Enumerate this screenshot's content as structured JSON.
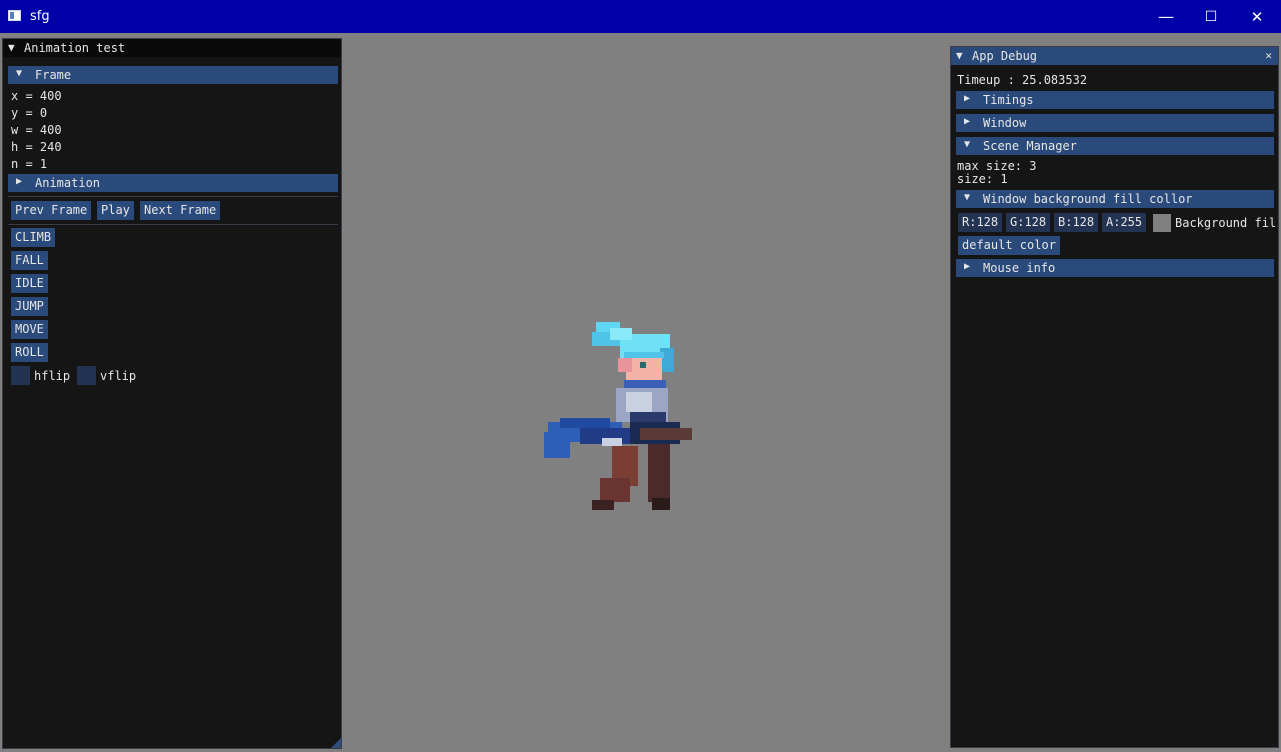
{
  "window": {
    "title": "sfg",
    "minimize": "—",
    "maximize": "☐",
    "close": "✕"
  },
  "left_panel": {
    "title": "Animation test",
    "frame_header": "Frame",
    "frame_lines": [
      "x = 400",
      "y = 0",
      "w = 400",
      "h = 240",
      "n = 1"
    ],
    "animation_header": "Animation",
    "controls": {
      "prev": "Prev Frame",
      "play": "Play",
      "next": "Next Frame"
    },
    "animations": [
      "CLIMB",
      "FALL",
      "IDLE",
      "JUMP",
      "MOVE",
      "ROLL"
    ],
    "hflip_label": "hflip",
    "vflip_label": "vflip"
  },
  "right_panel": {
    "title": "App Debug",
    "close": "✕",
    "timeup": "Timeup : 25.083532",
    "timings_header": "Timings",
    "window_header": "Window",
    "scene_header": "Scene Manager",
    "max_size": "max size: 3",
    "size": "size: 1",
    "bg_header": "Window background fill collor",
    "r": "R:128",
    "g": "G:128",
    "b": "B:128",
    "a": "A:255",
    "bg_label": "Background fil",
    "default_color": "default color",
    "mouse_header": "Mouse info"
  },
  "colors": {
    "accent": "#294a7a",
    "background_fill": "#808080",
    "titlebar": "#0000a8"
  }
}
